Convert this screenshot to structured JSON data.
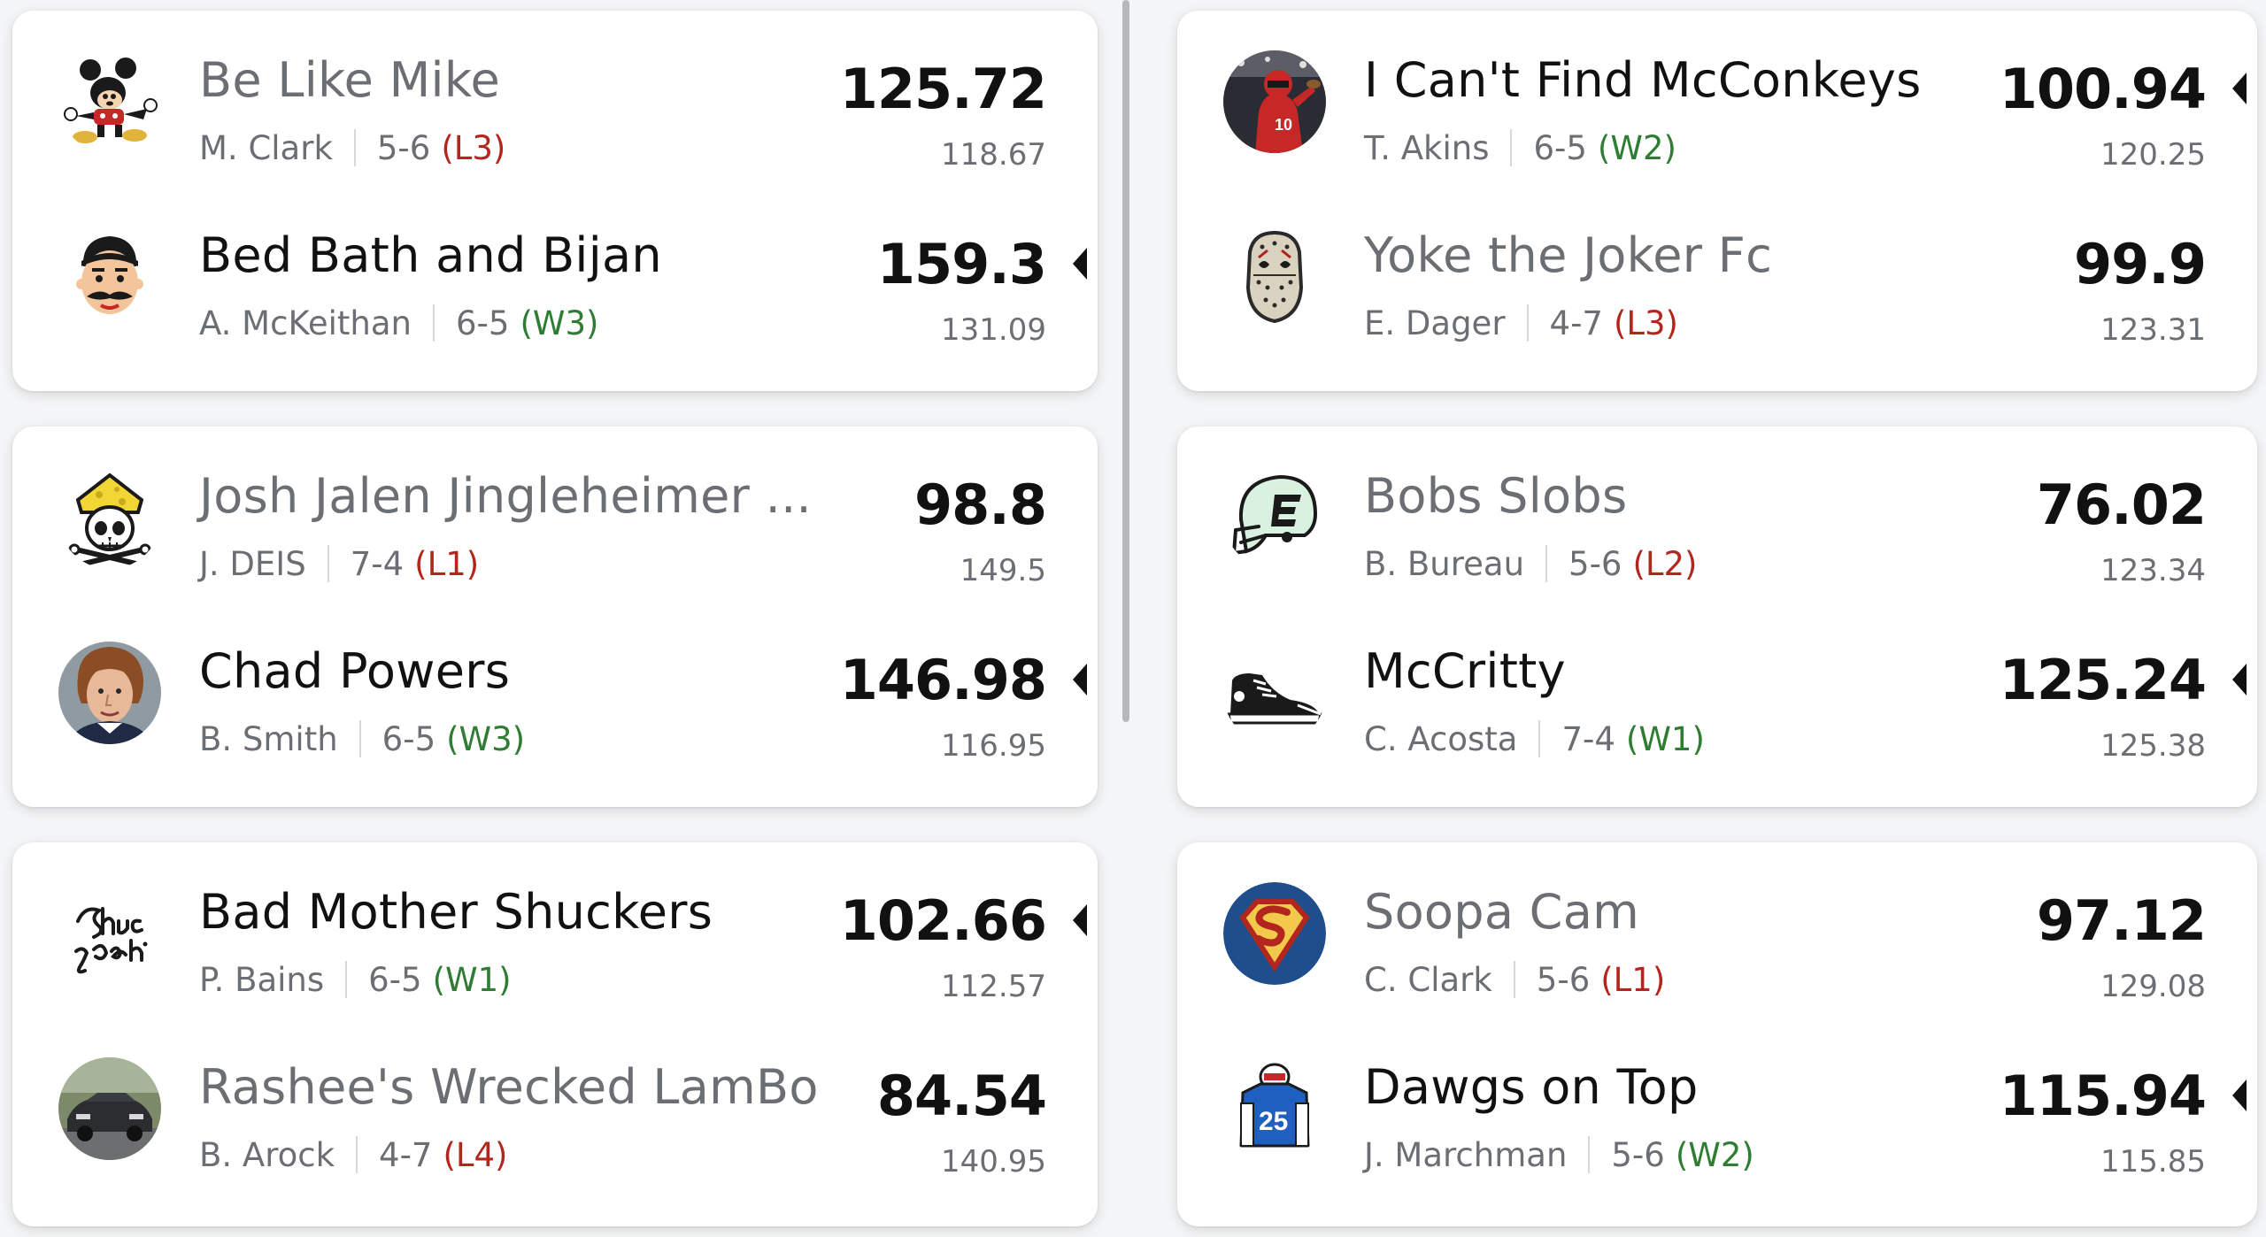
{
  "left_column": [
    {
      "teams": [
        {
          "name": "Be Like Mike",
          "owner": "M. Clark",
          "record": "5-6",
          "streak": "(L3)",
          "streak_type": "loss",
          "score": "125.72",
          "projection": "118.67",
          "winner": false,
          "icon": "mickey-mouse-icon"
        },
        {
          "name": "Bed Bath and Bijan",
          "owner": "A. McKeithan",
          "record": "6-5",
          "streak": "(W3)",
          "streak_type": "win",
          "score": "159.3",
          "projection": "131.09",
          "winner": true,
          "icon": "mustache-man-icon"
        }
      ]
    },
    {
      "teams": [
        {
          "name": "Josh Jalen Jingleheimer ...",
          "owner": "J. DEIS",
          "record": "7-4",
          "streak": "(L1)",
          "streak_type": "loss",
          "score": "98.8",
          "projection": "149.5",
          "winner": false,
          "icon": "cheese-skull-icon"
        },
        {
          "name": "Chad Powers",
          "owner": "B. Smith",
          "record": "6-5",
          "streak": "(W3)",
          "streak_type": "win",
          "score": "146.98",
          "projection": "116.95",
          "winner": true,
          "icon": "player-face-icon"
        }
      ]
    },
    {
      "teams": [
        {
          "name": "Bad Mother Shuckers",
          "owner": "P. Bains",
          "record": "6-5",
          "streak": "(W1)",
          "streak_type": "win",
          "score": "102.66",
          "projection": "112.57",
          "winner": true,
          "icon": "shuck-yeah-script-icon"
        },
        {
          "name": "Rashee's Wrecked LamBo",
          "owner": "B. Arock",
          "record": "4-7",
          "streak": "(L4)",
          "streak_type": "loss",
          "score": "84.54",
          "projection": "140.95",
          "winner": false,
          "icon": "car-photo-icon"
        }
      ]
    }
  ],
  "right_column": [
    {
      "teams": [
        {
          "name": "I Can't Find McConkeys",
          "owner": "T. Akins",
          "record": "6-5",
          "streak": "(W2)",
          "streak_type": "win",
          "score": "100.94",
          "projection": "120.25",
          "winner": true,
          "icon": "football-player-photo-icon"
        },
        {
          "name": "Yoke the Joker Fc",
          "owner": "E. Dager",
          "record": "4-7",
          "streak": "(L3)",
          "streak_type": "loss",
          "score": "99.9",
          "projection": "123.31",
          "winner": false,
          "icon": "hockey-mask-icon"
        }
      ]
    },
    {
      "teams": [
        {
          "name": "Bobs Slobs",
          "owner": "B. Bureau",
          "record": "5-6",
          "streak": "(L2)",
          "streak_type": "loss",
          "score": "76.02",
          "projection": "123.34",
          "winner": false,
          "icon": "espn-helmet-icon"
        },
        {
          "name": "McCritty",
          "owner": "C. Acosta",
          "record": "7-4",
          "streak": "(W1)",
          "streak_type": "win",
          "score": "125.24",
          "projection": "125.38",
          "winner": true,
          "icon": "sneaker-icon"
        }
      ]
    },
    {
      "teams": [
        {
          "name": "Soopa Cam",
          "owner": "C. Clark",
          "record": "5-6",
          "streak": "(L1)",
          "streak_type": "loss",
          "score": "97.12",
          "projection": "129.08",
          "winner": false,
          "icon": "superman-shield-icon"
        },
        {
          "name": "Dawgs on Top",
          "owner": "J. Marchman",
          "record": "5-6",
          "streak": "(W2)",
          "streak_type": "win",
          "score": "115.94",
          "projection": "115.85",
          "winner": true,
          "icon": "jersey-25-icon"
        }
      ]
    }
  ],
  "colors": {
    "win_streak": "#2e7d32",
    "loss_streak": "#b3261e",
    "winner_text": "#111111",
    "loser_text": "#6b6e72"
  }
}
